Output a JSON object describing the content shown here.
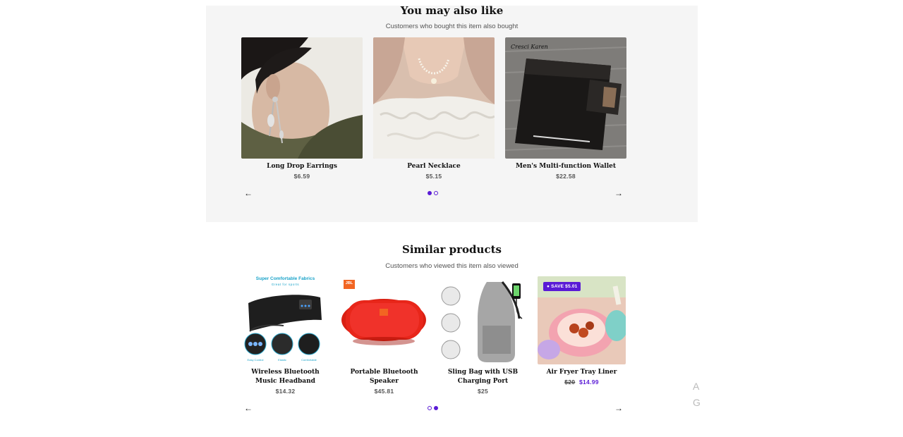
{
  "also_like": {
    "title": "You may also like",
    "subtitle": "Customers who bought this item also bought",
    "products": [
      {
        "name": "Long Drop Earrings",
        "price": "$6.59"
      },
      {
        "name": "Pearl Necklace",
        "price": "$5.15"
      },
      {
        "name": "Men's Multi-function Wallet",
        "price": "$22.58",
        "image_text": "Cresci Karen"
      }
    ],
    "pagination": {
      "active": 1,
      "total": 2
    }
  },
  "similar": {
    "title": "Similar products",
    "subtitle": "Customers who viewed this item also viewed",
    "products": [
      {
        "name": "Wireless Bluetooth Music Headband",
        "price": "$14.32",
        "image_text": {
          "headline": "Super Comfortable Fabrics",
          "tagline": "Great for sports",
          "features": [
            "Easy Control",
            "Elastic",
            "Comfortable"
          ]
        }
      },
      {
        "name": "Portable Bluetooth Speaker",
        "price": "$45.81",
        "image_text": "JBL"
      },
      {
        "name": "Sling Bag with USB Charging Port",
        "price": "$25"
      },
      {
        "name": "Air Fryer Tray Liner",
        "old_price": "$20",
        "price": "$14.99",
        "badge": "SAVE $5.01"
      }
    ],
    "pagination": {
      "active": 2,
      "total": 2
    }
  },
  "edge_text": [
    "A",
    "G"
  ],
  "colors": {
    "accent": "#5a1bd6",
    "section_bg": "#f5f5f5"
  },
  "icons": {
    "prev": "arrow-left-icon",
    "next": "arrow-right-icon",
    "badge": "tag-icon"
  }
}
